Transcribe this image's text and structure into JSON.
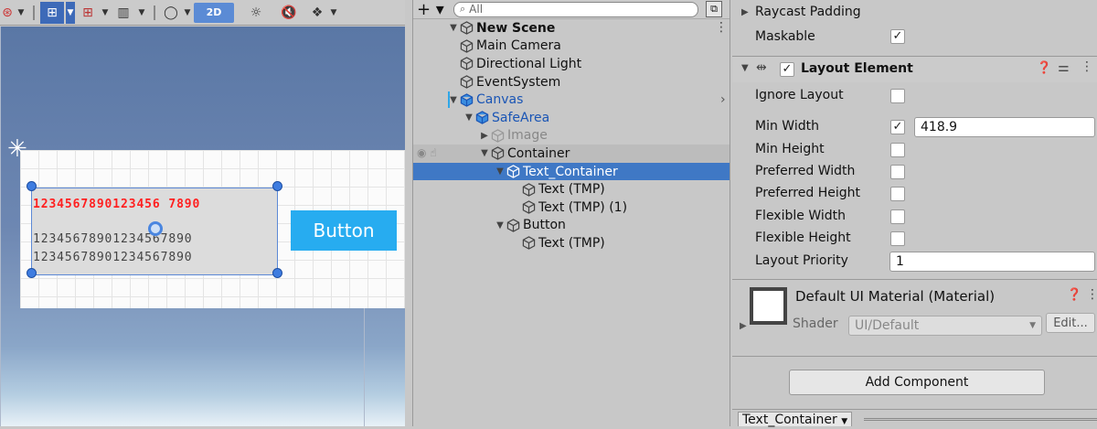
{
  "scene": {
    "toolbar": {
      "mode_2d": "2D"
    },
    "row_red": "1234567890123456 7890",
    "row_a": "12345678901234567890",
    "row_b": "12345678901234567890",
    "button_label": "Button",
    "colors": {
      "canvas_bg": "#fbfbfb",
      "button": "#27acf0",
      "red_text": "#ff2020",
      "handle": "#3e7ce0"
    }
  },
  "hierarchy": {
    "search_placeholder": "All",
    "items": [
      {
        "label": "New Scene",
        "depth": 0,
        "expanded": true,
        "bold": true
      },
      {
        "label": "Main Camera",
        "depth": 1
      },
      {
        "label": "Directional Light",
        "depth": 1
      },
      {
        "label": "EventSystem",
        "depth": 1
      },
      {
        "label": "Canvas",
        "depth": 1,
        "expanded": true,
        "blue": true
      },
      {
        "label": "SafeArea",
        "depth": 2,
        "expanded": true,
        "blue": true
      },
      {
        "label": "Image",
        "depth": 3,
        "collapsed": true,
        "gray": true
      },
      {
        "label": "Container",
        "depth": 3,
        "expanded": true
      },
      {
        "label": "Text_Container",
        "depth": 4,
        "expanded": true,
        "selected": true
      },
      {
        "label": "Text (TMP)",
        "depth": 5
      },
      {
        "label": "Text (TMP) (1)",
        "depth": 5
      },
      {
        "label": "Button",
        "depth": 4,
        "expanded": true
      },
      {
        "label": "Text (TMP)",
        "depth": 5
      }
    ]
  },
  "inspector": {
    "raycast_padding": "Raycast Padding",
    "maskable": "Maskable",
    "layout_element_title": "Layout Element",
    "fields": {
      "ignore_layout": "Ignore Layout",
      "min_width": "Min Width",
      "min_width_value": "418.9",
      "min_height": "Min Height",
      "preferred_width": "Preferred Width",
      "preferred_height": "Preferred Height",
      "flexible_width": "Flexible Width",
      "flexible_height": "Flexible Height",
      "layout_priority": "Layout Priority",
      "layout_priority_value": "1"
    },
    "material": {
      "title": "Default UI Material (Material)",
      "shader_label": "Shader",
      "shader_value": "UI/Default",
      "edit_label": "Edit..."
    },
    "add_component": "Add Component",
    "bottom_tab": "Text_Container"
  }
}
